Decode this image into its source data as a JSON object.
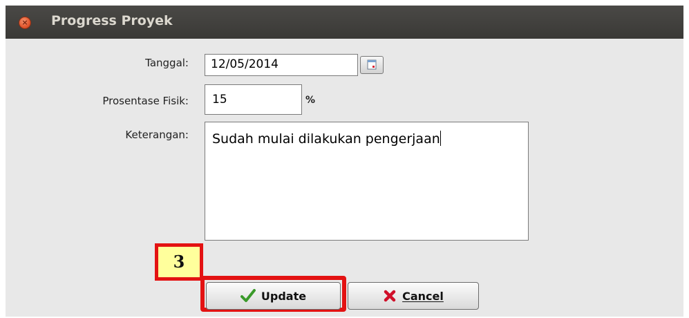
{
  "window": {
    "title": "Progress Proyek"
  },
  "form": {
    "tanggal_label": "Tanggal:",
    "tanggal_value": "12/05/2014",
    "fisik_label": "Prosentase Fisik:",
    "fisik_value": "15",
    "fisik_unit": "%",
    "keterangan_label": "Keterangan:",
    "keterangan_value": "Sudah mulai dilakukan pengerjaan"
  },
  "buttons": {
    "update_label": "Update",
    "cancel_label": "Cancel"
  },
  "annotation": {
    "step_number": "3",
    "highlight_color": "#e31212",
    "badge_color": "#ffff9c"
  },
  "icons": {
    "close": "close-icon",
    "calendar": "calendar-icon",
    "update": "checkmark-icon",
    "cancel": "x-icon"
  }
}
